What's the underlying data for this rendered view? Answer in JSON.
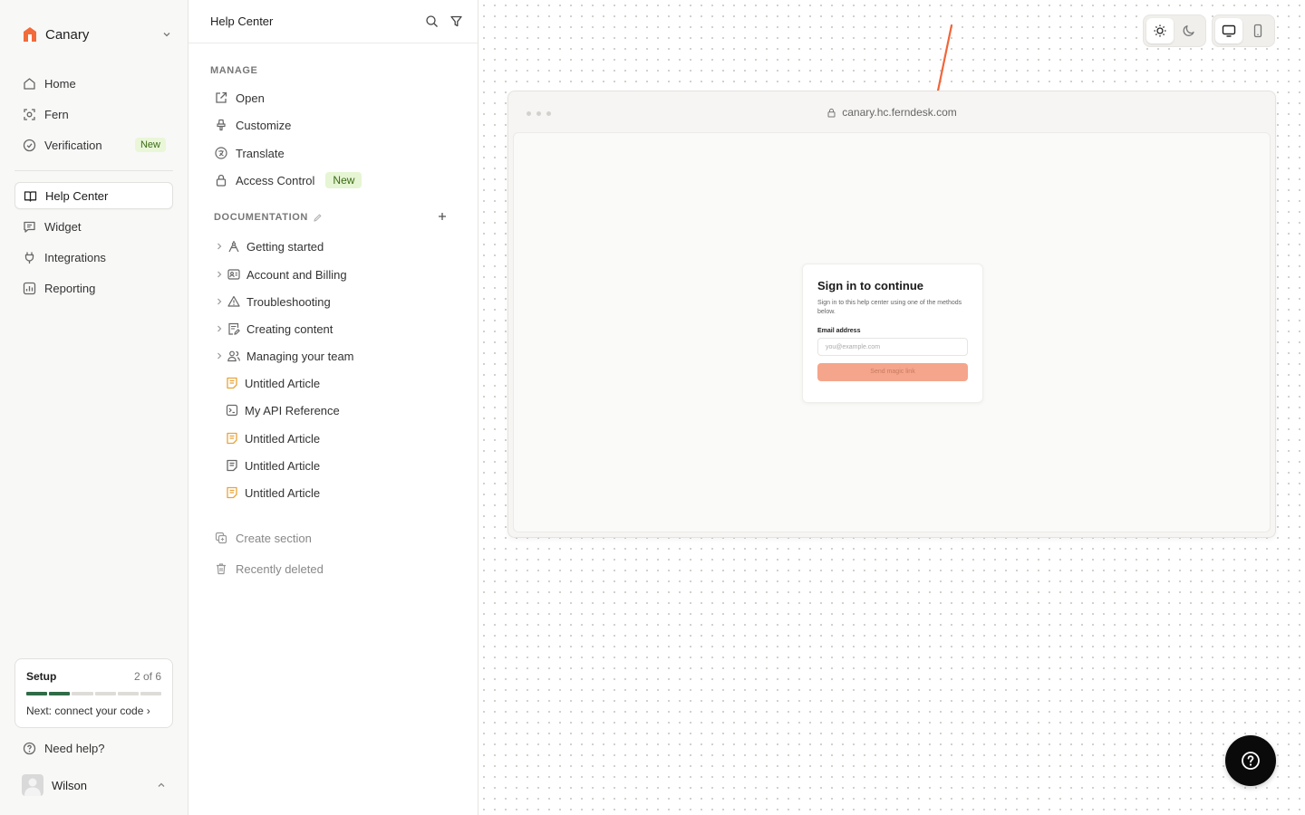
{
  "sidebar": {
    "workspace": "Canary",
    "nav_top": [
      {
        "label": "Home",
        "icon": "home-icon"
      },
      {
        "label": "Fern",
        "icon": "fern-icon"
      },
      {
        "label": "Verification",
        "icon": "check-circle-icon",
        "badge": "New"
      }
    ],
    "nav_main": [
      {
        "label": "Help Center",
        "icon": "book-icon",
        "active": true
      },
      {
        "label": "Widget",
        "icon": "chat-icon"
      },
      {
        "label": "Integrations",
        "icon": "plug-icon"
      },
      {
        "label": "Reporting",
        "icon": "chart-icon"
      }
    ],
    "setup": {
      "title": "Setup",
      "count": "2 of 6",
      "progress": 0.333,
      "next": "Next: connect your code ›"
    },
    "help": "Need help?",
    "user": "Wilson"
  },
  "panel": {
    "title": "Help Center",
    "manage_label": "MANAGE",
    "manage": [
      {
        "label": "Open",
        "icon": "external-link-icon"
      },
      {
        "label": "Customize",
        "icon": "brush-icon"
      },
      {
        "label": "Translate",
        "icon": "translate-icon"
      },
      {
        "label": "Access Control",
        "icon": "lock-icon",
        "badge": "New"
      }
    ],
    "documentation_label": "DOCUMENTATION",
    "docs": [
      {
        "label": "Getting started",
        "icon": "signpost-icon",
        "expandable": true
      },
      {
        "label": "Account and Billing",
        "icon": "id-card-icon",
        "expandable": true
      },
      {
        "label": "Troubleshooting",
        "icon": "warning-icon",
        "expandable": true
      },
      {
        "label": "Creating content",
        "icon": "document-edit-icon",
        "expandable": true
      },
      {
        "label": "Managing your team",
        "icon": "users-icon",
        "expandable": true
      },
      {
        "label": "Untitled Article",
        "icon": "draft-article-icon",
        "draft": true
      },
      {
        "label": "My API Reference",
        "icon": "terminal-icon"
      },
      {
        "label": "Untitled Article",
        "icon": "draft-article-icon",
        "draft": true
      },
      {
        "label": "Untitled Article",
        "icon": "article-icon"
      },
      {
        "label": "Untitled Article",
        "icon": "draft-article-icon",
        "draft": true
      }
    ],
    "create_section": "Create section",
    "recently_deleted": "Recently deleted"
  },
  "preview": {
    "url": "canary.hc.ferndesk.com",
    "signin_title": "Sign in to continue",
    "signin_sub": "Sign in to this help center using one of the methods below.",
    "email_label": "Email address",
    "email_placeholder": "you@example.com",
    "button_label": "Send magic link"
  },
  "colors": {
    "accent": "#f26b3a",
    "progress": "#2f6b48",
    "badge_bg": "#e6f5d3",
    "draft_icon": "#e8a33a"
  }
}
